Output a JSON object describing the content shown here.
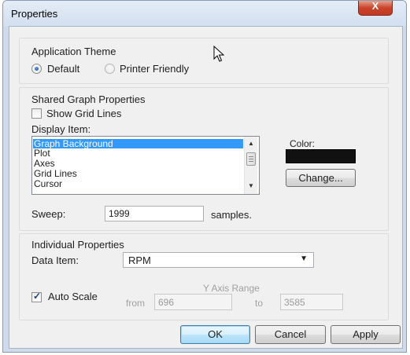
{
  "window": {
    "title": "Properties",
    "close_label": "X"
  },
  "app_theme": {
    "heading": "Application Theme",
    "options": [
      {
        "label": "Default",
        "checked": true
      },
      {
        "label": "Printer Friendly",
        "checked": false
      }
    ]
  },
  "shared": {
    "heading": "Shared Graph Properties",
    "show_grid_lines": {
      "label": "Show Grid Lines",
      "checked": false
    },
    "display_item_label": "Display Item:",
    "display_items": [
      "Graph Background",
      "Plot",
      "Axes",
      "Grid Lines",
      "Cursor"
    ],
    "selected_item": "Graph Background",
    "color_label": "Color:",
    "color_value": "#111111",
    "change_button": "Change..."
  },
  "sweep": {
    "label": "Sweep:",
    "value": "1999",
    "unit": "samples."
  },
  "individual": {
    "heading": "Individual Properties",
    "data_item_label": "Data Item:",
    "data_item_value": "RPM",
    "auto_scale": {
      "label": "Auto Scale",
      "checked": true
    },
    "y_axis_range_label": "Y Axis Range",
    "from_label": "from",
    "from_value": "696",
    "to_label": "to",
    "to_value": "3585"
  },
  "buttons": {
    "ok": "OK",
    "cancel": "Cancel",
    "apply": "Apply"
  },
  "colors": {
    "selection": "#3399ff",
    "close_button": "#c9432a"
  }
}
